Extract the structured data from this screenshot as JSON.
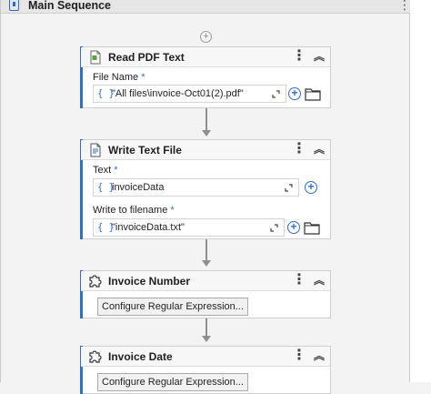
{
  "sequence": {
    "title": "Main Sequence",
    "menu": "⋮",
    "add": "+"
  },
  "activities": [
    {
      "title": "Read PDF Text",
      "fields": [
        {
          "label": "File Name",
          "required": "*",
          "value": "\"All files\\invoice-Oct01(2).pdf\""
        }
      ]
    },
    {
      "title": "Write Text File",
      "fields": [
        {
          "label": "Text",
          "required": "*",
          "value": "invoiceData"
        },
        {
          "label": "Write to filename",
          "required": "*",
          "value": "\"invoiceData.txt\""
        }
      ]
    },
    {
      "title": "Invoice Number",
      "button": "Configure Regular Expression..."
    },
    {
      "title": "Invoice Date",
      "button": "Configure Regular Expression..."
    }
  ],
  "glyphs": {
    "kebab": "⋮",
    "collapse": "︽",
    "brace": "{ }",
    "plus": "+"
  },
  "colors": {
    "accent": "#2f6ecb",
    "connector": "#8f8f8f"
  }
}
